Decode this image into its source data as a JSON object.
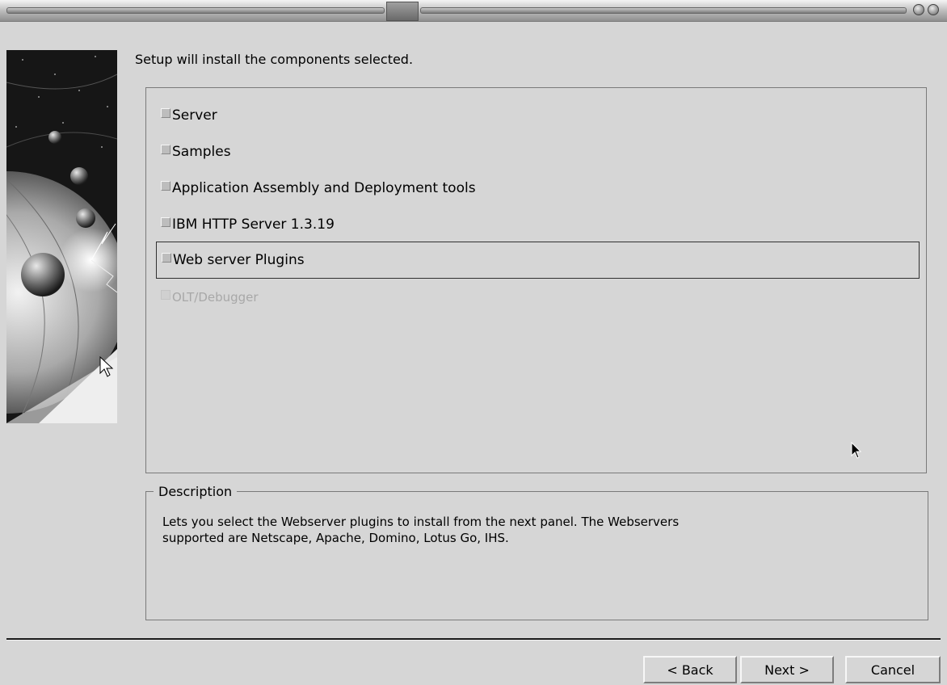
{
  "heading": "Setup will install the components selected.",
  "components": [
    {
      "label": "Server",
      "checked": false,
      "enabled": true,
      "focused": false
    },
    {
      "label": "Samples",
      "checked": false,
      "enabled": true,
      "focused": false
    },
    {
      "label": "Application Assembly and Deployment tools",
      "checked": false,
      "enabled": true,
      "focused": false
    },
    {
      "label": "IBM HTTP Server 1.3.19",
      "checked": false,
      "enabled": true,
      "focused": false
    },
    {
      "label": "Web server Plugins",
      "checked": false,
      "enabled": true,
      "focused": true
    },
    {
      "label": "OLT/Debugger",
      "checked": false,
      "enabled": false,
      "focused": false
    }
  ],
  "description": {
    "legend": "Description",
    "text_line1": "Lets you select the Webserver plugins to install from the next panel. The Webservers",
    "text_line2": "supported are Netscape, Apache, Domino, Lotus Go, IHS."
  },
  "buttons": {
    "back": "< Back",
    "next": "Next >",
    "cancel": "Cancel"
  },
  "icons": {
    "window_controls": [
      "minimize-icon",
      "close-icon"
    ],
    "cursors": [
      "arrow-cursor-icon"
    ]
  }
}
